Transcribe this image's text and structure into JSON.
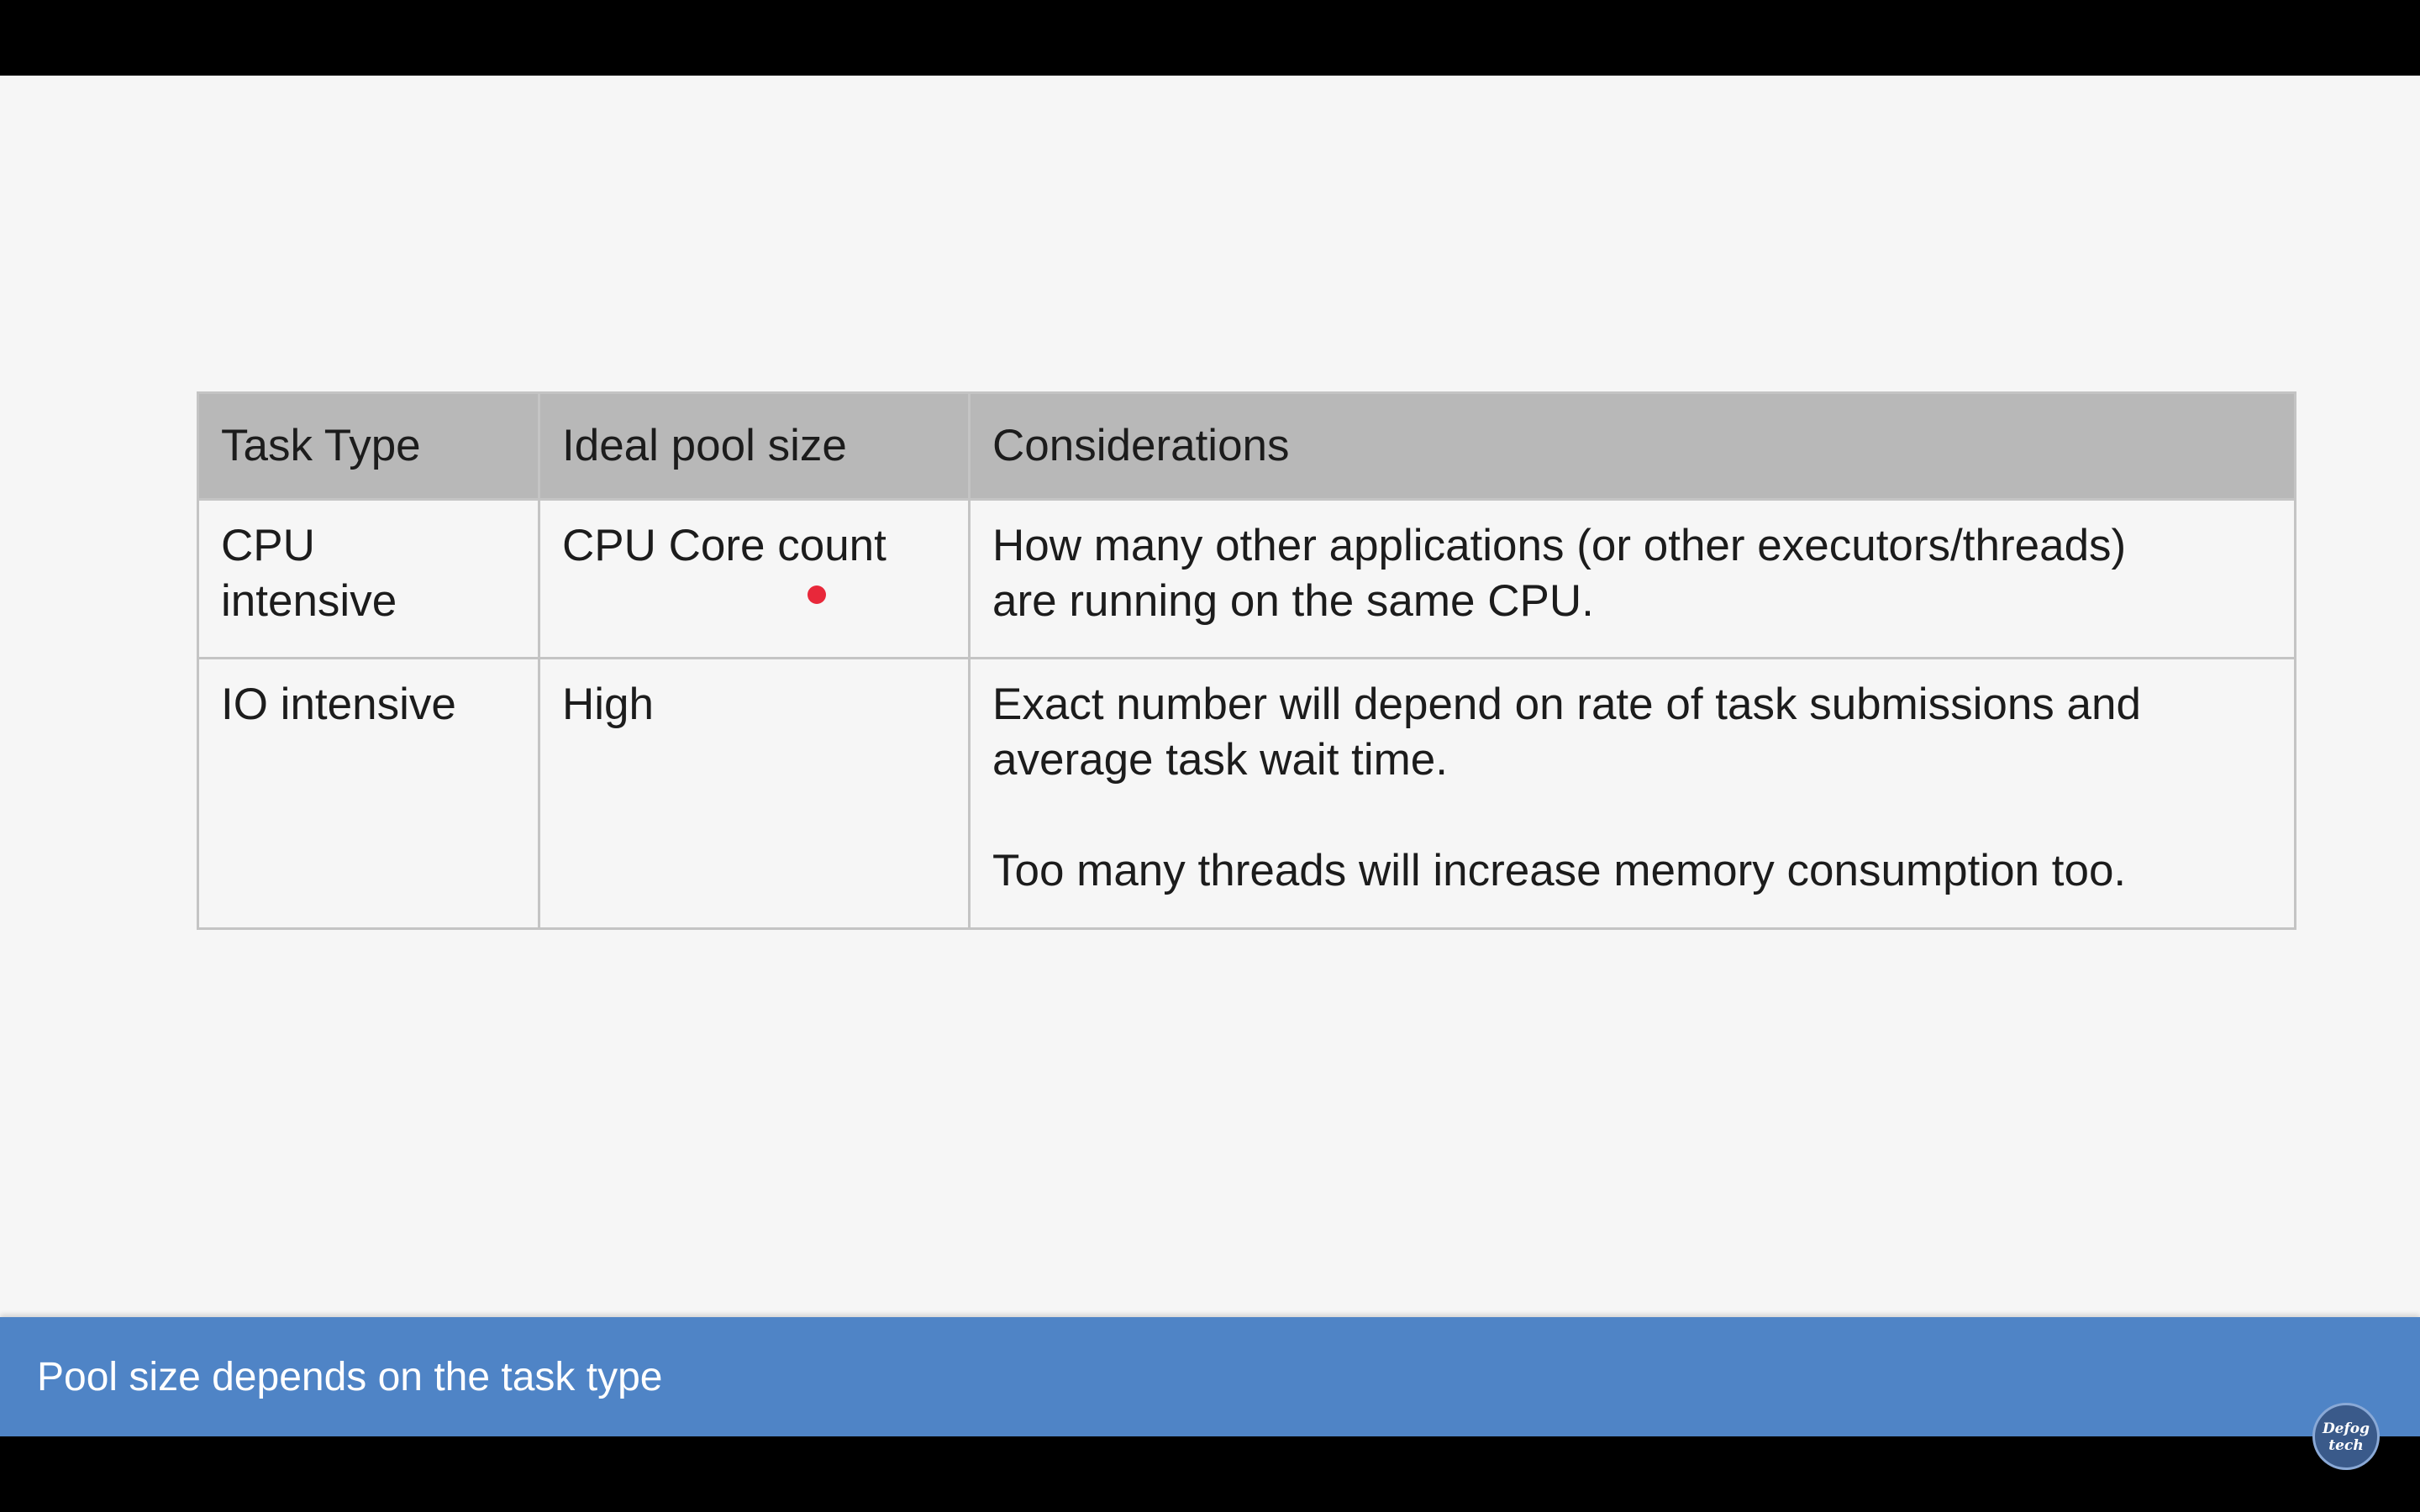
{
  "table": {
    "headers": [
      "Task Type",
      "Ideal pool size",
      "Considerations"
    ],
    "rows": [
      {
        "task_type_line1": "CPU",
        "task_type_line2": "intensive",
        "pool_size": "CPU Core count",
        "considerations_line1": "How many other applications (or other executors/threads)",
        "considerations_line2": "are running on the same CPU."
      },
      {
        "task_type": "IO intensive",
        "pool_size": "High",
        "considerations_p1_line1": "Exact number will depend on rate of task submissions and",
        "considerations_p1_line2": "average task wait time.",
        "considerations_p2": "Too many threads will increase memory consumption too."
      }
    ]
  },
  "caption": {
    "text": "Pool size depends on the task type"
  },
  "logo": {
    "line1": "Defog",
    "line2": "tech"
  },
  "colors": {
    "header_bg": "#b8b8b8",
    "caption_bar": "#4f84c6",
    "pointer": "#e8283a",
    "slide_bg": "#f6f6f6"
  }
}
